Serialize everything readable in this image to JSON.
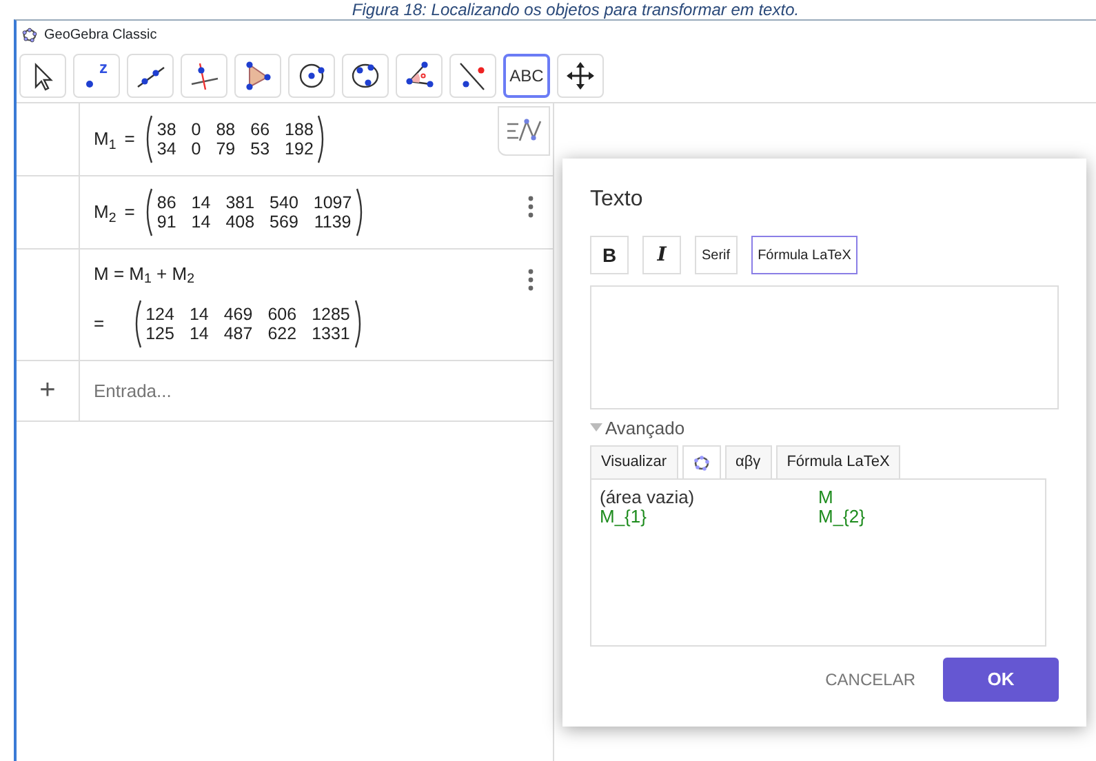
{
  "caption": "Figura 18: Localizando os objetos para transformar em texto.",
  "window": {
    "title": "GeoGebra Classic"
  },
  "toolbar": [
    {
      "kind": "move",
      "selected": false
    },
    {
      "kind": "point",
      "label": "z",
      "selected": false
    },
    {
      "kind": "line",
      "selected": false
    },
    {
      "kind": "perpendicular",
      "selected": false
    },
    {
      "kind": "polygon",
      "selected": false
    },
    {
      "kind": "circle",
      "selected": false
    },
    {
      "kind": "conic",
      "selected": false
    },
    {
      "kind": "angle",
      "selected": false
    },
    {
      "kind": "reflect",
      "selected": false
    },
    {
      "kind": "text",
      "label": "ABC",
      "selected": true
    },
    {
      "kind": "pan",
      "selected": false
    }
  ],
  "algebra": {
    "rows": [
      {
        "kind": "matrix",
        "lhs": "M$_{1}$",
        "eq": "=",
        "matrix": [
          [
            "38",
            "0",
            "88",
            "66",
            "188"
          ],
          [
            "34",
            "0",
            "79",
            "53",
            "192"
          ]
        ]
      },
      {
        "kind": "matrix",
        "lhs": "M$_{2}$",
        "eq": "=",
        "menu": true,
        "matrix": [
          [
            "86",
            "14",
            "381",
            "540",
            "1097"
          ],
          [
            "91",
            "14",
            "408",
            "569",
            "1139"
          ]
        ]
      },
      {
        "kind": "definition",
        "definition": "M = M$_{1}$ + M$_{2}$",
        "eq": "=",
        "menu": true,
        "matrix": [
          [
            "124",
            "14",
            "469",
            "606",
            "1285"
          ],
          [
            "125",
            "14",
            "487",
            "622",
            "1331"
          ]
        ]
      }
    ],
    "input": {
      "marker": "+",
      "placeholder": "Entrada..."
    }
  },
  "dialog": {
    "title": "Texto",
    "format_buttons": [
      {
        "kind": "bold",
        "label": "B",
        "selected": false
      },
      {
        "kind": "italic",
        "label": "I",
        "selected": false
      },
      {
        "kind": "plain",
        "label": "Serif",
        "selected": false
      },
      {
        "kind": "plain",
        "label": "Fórmula LaTeX",
        "selected": true
      }
    ],
    "advanced": {
      "label": "Avançado",
      "expanded": true
    },
    "tabs": [
      {
        "kind": "text",
        "label": "Visualizar",
        "selected": false
      },
      {
        "kind": "icon",
        "selected": true
      },
      {
        "kind": "text",
        "label": "αβγ",
        "selected": false
      },
      {
        "kind": "text",
        "label": "Fórmula LaTeX",
        "selected": false
      }
    ],
    "objects": [
      {
        "label": "(área vazia)",
        "color": "#333333"
      },
      {
        "label": "M",
        "color": "#1e8c1e"
      },
      {
        "label": "M_{1}",
        "color": "#1e8c1e"
      },
      {
        "label": "M_{2}",
        "color": "#1e8c1e"
      }
    ],
    "buttons": [
      {
        "kind": "cancel",
        "label": "CANCELAR"
      },
      {
        "kind": "ok",
        "label": "OK"
      }
    ]
  }
}
